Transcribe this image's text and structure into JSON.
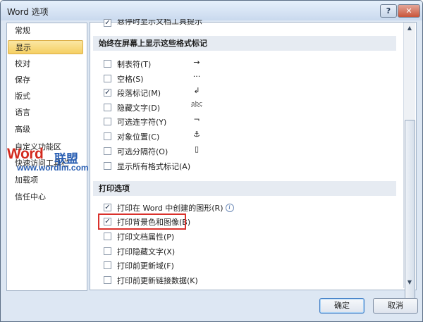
{
  "window": {
    "title": "Word 选项"
  },
  "sidebar": {
    "items": [
      {
        "label": "常规",
        "selected": false
      },
      {
        "label": "显示",
        "selected": true
      },
      {
        "label": "校对",
        "selected": false
      },
      {
        "label": "保存",
        "selected": false
      },
      {
        "label": "版式",
        "selected": false
      },
      {
        "label": "语言",
        "selected": false
      },
      {
        "label": "高级",
        "selected": false
      },
      {
        "label": "自定义功能区",
        "selected": false
      },
      {
        "label": "快速访问工具栏",
        "selected": false
      },
      {
        "label": "加载项",
        "selected": false
      },
      {
        "label": "信任中心",
        "selected": false
      }
    ]
  },
  "watermark": {
    "brand_word": "Word",
    "brand_cn": "联盟",
    "url": "www.wordlm.com"
  },
  "top_partial_option": {
    "label": "悬停时显示文档工具提示",
    "checked": true
  },
  "format_marks": {
    "heading": "始终在屏幕上显示这些格式标记",
    "options": [
      {
        "label": "制表符(T)",
        "checked": false,
        "symbol": "→"
      },
      {
        "label": "空格(S)",
        "checked": false,
        "symbol": "···"
      },
      {
        "label": "段落标记(M)",
        "checked": true,
        "symbol": "↲"
      },
      {
        "label": "隐藏文字(D)",
        "checked": false,
        "symbol": "abc"
      },
      {
        "label": "可选连字符(Y)",
        "checked": false,
        "symbol": "¬"
      },
      {
        "label": "对象位置(C)",
        "checked": false,
        "symbol": "⚓"
      },
      {
        "label": "可选分隔符(O)",
        "checked": false,
        "symbol": "▯"
      },
      {
        "label": "显示所有格式标记(A)",
        "checked": false,
        "symbol": ""
      }
    ]
  },
  "print_options": {
    "heading": "打印选项",
    "options": [
      {
        "label": "打印在 Word 中创建的图形(R)",
        "checked": true,
        "info": true
      },
      {
        "label": "打印背景色和图像(B)",
        "checked": true,
        "highlighted": true
      },
      {
        "label": "打印文档属性(P)",
        "checked": false
      },
      {
        "label": "打印隐藏文字(X)",
        "checked": false
      },
      {
        "label": "打印前更新域(F)",
        "checked": false
      },
      {
        "label": "打印前更新链接数据(K)",
        "checked": false
      }
    ]
  },
  "buttons": {
    "ok": "确定",
    "cancel": "取消"
  },
  "colors": {
    "highlight": "#d9312c",
    "selected_nav": "#f5cf62",
    "section_bg": "#e6ebf2"
  }
}
